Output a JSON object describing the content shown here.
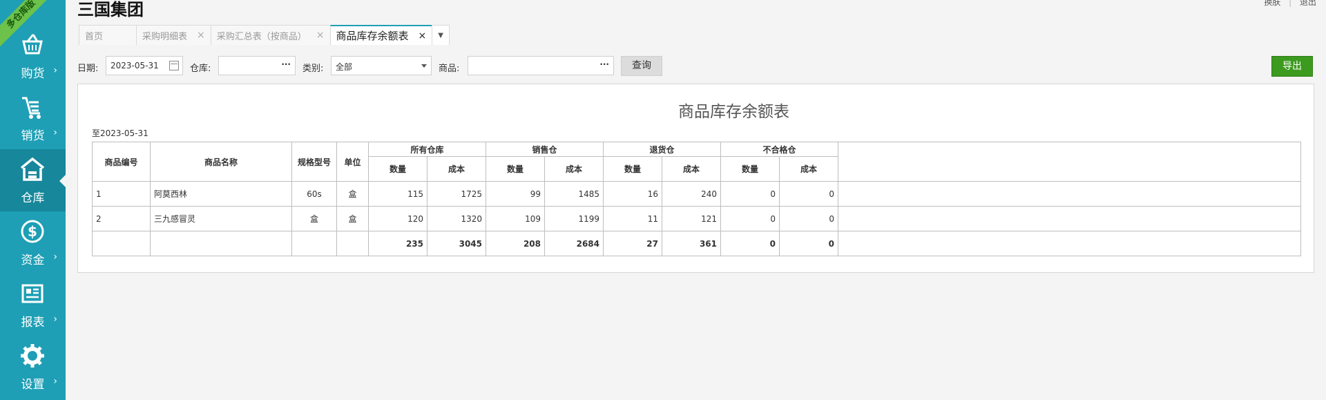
{
  "app": {
    "company": "三国集团",
    "ribbon": "多仓库版",
    "user_links": [
      "换肤",
      "退出"
    ]
  },
  "sidebar": {
    "items": [
      {
        "label": "购货",
        "icon": "basket-icon"
      },
      {
        "label": "销货",
        "icon": "cart-icon"
      },
      {
        "label": "仓库",
        "icon": "warehouse-icon",
        "active": true
      },
      {
        "label": "资金",
        "icon": "dollar-icon"
      },
      {
        "label": "报表",
        "icon": "report-icon"
      },
      {
        "label": "设置",
        "icon": "gear-icon"
      }
    ]
  },
  "tabs": [
    {
      "label": "首页"
    },
    {
      "label": "采购明细表"
    },
    {
      "label": "采购汇总表（按商品）"
    },
    {
      "label": "商品库存余额表",
      "active": true
    }
  ],
  "filter": {
    "date_label": "日期:",
    "date_value": "2023-05-31",
    "warehouse_label": "仓库:",
    "warehouse_value": "",
    "category_label": "类别:",
    "category_value": "全部",
    "goods_label": "商品:",
    "goods_value": "",
    "query_button": "查询",
    "export_button": "导出"
  },
  "report": {
    "title": "商品库存余额表",
    "date_range": "至2023-05-31",
    "columns": {
      "code": "商品编号",
      "name": "商品名称",
      "spec": "规格型号",
      "unit": "单位",
      "groups": [
        "所有仓库",
        "销售仓",
        "退货仓",
        "不合格仓"
      ],
      "qty": "数量",
      "cost": "成本"
    },
    "rows": [
      {
        "code": "1",
        "name": "阿莫西林",
        "spec": "60s",
        "unit": "盒",
        "vals": [
          "115",
          "1725",
          "99",
          "1485",
          "16",
          "240",
          "0",
          "0"
        ]
      },
      {
        "code": "2",
        "name": "三九感冒灵",
        "spec": "盒",
        "unit": "盒",
        "vals": [
          "120",
          "1320",
          "109",
          "1199",
          "11",
          "121",
          "0",
          "0"
        ]
      }
    ],
    "totals": [
      "235",
      "3045",
      "208",
      "2684",
      "27",
      "361",
      "0",
      "0"
    ]
  }
}
